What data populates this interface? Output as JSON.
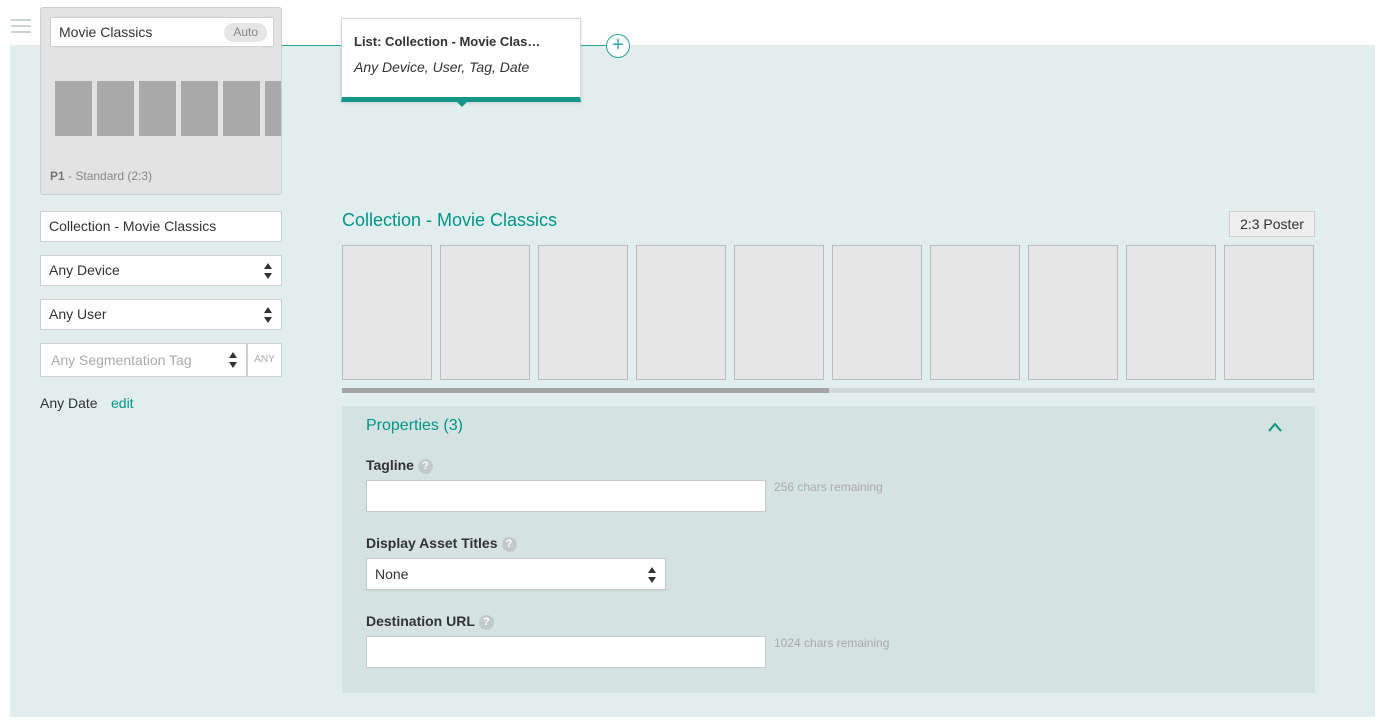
{
  "card": {
    "title": "Movie Classics",
    "auto_label": "Auto",
    "thumb_count": 6,
    "footer_bold": "P1",
    "footer_text": " - Standard (2:3)"
  },
  "left": {
    "collection_name": "Collection - Movie Classics",
    "device_select": "Any Device",
    "user_select": "Any User",
    "segmentation_placeholder": "Any Segmentation Tag",
    "any_label": "ANY",
    "date_label": "Any Date",
    "edit_label": "edit"
  },
  "popover": {
    "title": "List: Collection - Movie Clas…",
    "subtitle": "Any Device, User, Tag, Date"
  },
  "collection": {
    "title": "Collection - Movie Classics",
    "format_label": "2:3 Poster",
    "thumb_count": 10,
    "scroll_position_fraction": 0.5
  },
  "properties": {
    "title": "Properties (3)",
    "tagline": {
      "label": "Tagline",
      "value": "",
      "remaining": "256 chars remaining"
    },
    "display_asset_titles": {
      "label": "Display Asset Titles",
      "value": "None"
    },
    "destination_url": {
      "label": "Destination URL",
      "value": "",
      "remaining": "1024 chars remaining"
    },
    "help_glyph": "?"
  },
  "colors": {
    "accent": "#009688",
    "panel_bg": "#e1eeed",
    "props_bg": "#d4e2e1"
  }
}
